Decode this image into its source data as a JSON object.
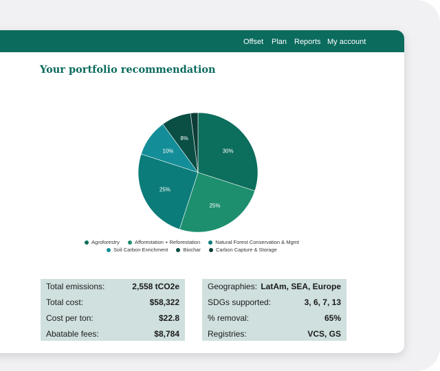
{
  "nav": {
    "items": [
      "Offset",
      "Plan",
      "Reports",
      "My account"
    ]
  },
  "page_title": "Your portfolio recommendation",
  "colors": {
    "brand": "#0b6b5d",
    "panel_bg": "#cfe0de"
  },
  "chart_data": {
    "type": "pie",
    "slices": [
      {
        "label": "Agroforestry",
        "value": 30,
        "display": "30%",
        "color": "#0c6e5c"
      },
      {
        "label": "Afforestation + Reforestation",
        "value": 25,
        "display": "25%",
        "color": "#1d8f6f"
      },
      {
        "label": "Natural Forest Conservation & Mgmt",
        "value": 25,
        "display": "25%",
        "color": "#0b7c7a"
      },
      {
        "label": "Soil Carbon Enrichment",
        "value": 10,
        "display": "10%",
        "color": "#138e98"
      },
      {
        "label": "Biochar",
        "value": 8,
        "display": "8%",
        "color": "#0a4e44"
      },
      {
        "label": "Carbon Capture & Storage",
        "value": 2,
        "display": "",
        "color": "#0d3d36"
      }
    ],
    "legend_rows": [
      [
        "Agroforestry",
        "Afforestation + Reforestation",
        "Natural Forest Conservation & Mgmt"
      ],
      [
        "Soil Carbon Enrichment",
        "Biochar",
        "Carbon Capture & Storage"
      ]
    ],
    "legend_position": "bottom"
  },
  "summary_left": [
    {
      "label": "Total emissions:",
      "value": "2,558 tCO2e"
    },
    {
      "label": "Total cost:",
      "value": "$58,322"
    },
    {
      "label": "Cost per ton:",
      "value": "$22.8"
    },
    {
      "label": "Abatable fees:",
      "value": "$8,784"
    }
  ],
  "summary_right": [
    {
      "label": "Geographies:",
      "value": "LatAm, SEA, Europe"
    },
    {
      "label": "SDGs supported:",
      "value": "3, 6, 7, 13"
    },
    {
      "label": "% removal:",
      "value": "65%"
    },
    {
      "label": "Registries:",
      "value": "VCS, GS"
    }
  ]
}
